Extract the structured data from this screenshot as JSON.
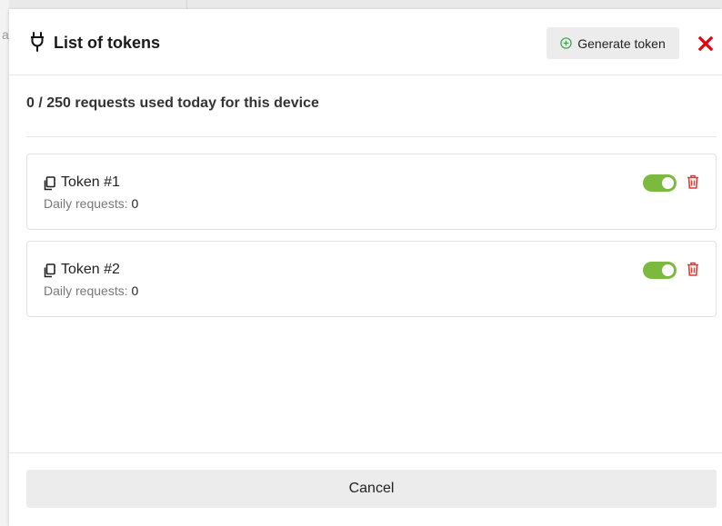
{
  "backdrop": {
    "fragment": "a"
  },
  "header": {
    "title": "List of tokens",
    "generate_label": "Generate token"
  },
  "usage_text": "0 / 250 requests used today for this device",
  "tokens": [
    {
      "name": "Token #1",
      "daily_label": "Daily requests:",
      "daily_value": "0",
      "enabled": true
    },
    {
      "name": "Token #2",
      "daily_label": "Daily requests:",
      "daily_value": "0",
      "enabled": true
    }
  ],
  "footer": {
    "cancel_label": "Cancel"
  },
  "colors": {
    "toggle_on": "#7cb93f",
    "delete_red": "#e53935",
    "close_red": "#e8000b",
    "add_green": "#3aa548"
  },
  "icons": {
    "title": "plug-icon",
    "generate": "plus-circle-icon",
    "close": "close-icon",
    "copy": "copy-icon",
    "delete": "trash-icon"
  }
}
